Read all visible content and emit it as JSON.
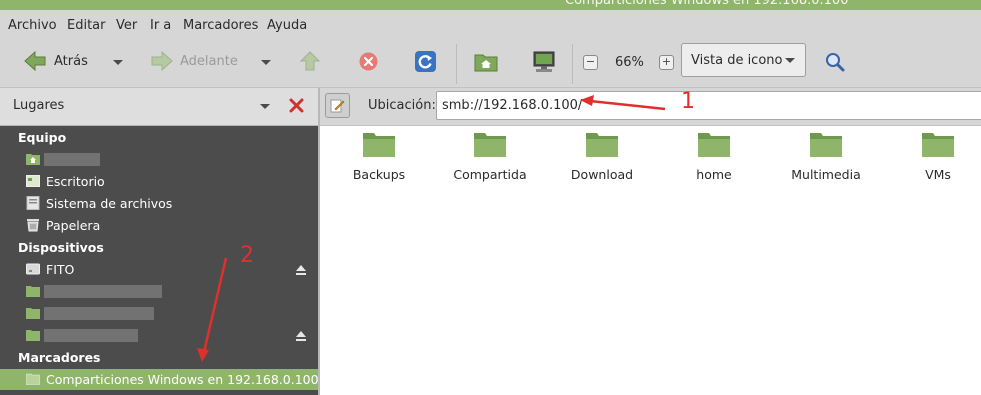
{
  "window": {
    "title": "Comparticiones Windows en 192.168.0.100"
  },
  "menubar": [
    "Archivo",
    "Editar",
    "Ver",
    "Ir a",
    "Marcadores",
    "Ayuda"
  ],
  "toolbar": {
    "back_label": "Atrás",
    "forward_label": "Adelante",
    "zoom_level": "66%",
    "view_mode": "Vista de icono"
  },
  "sidebar": {
    "header_title": "Lugares",
    "sections": {
      "equipo": "Equipo",
      "dispositivos": "Dispositivos",
      "marcadores": "Marcadores"
    },
    "equipo_items": [
      "Escritorio",
      "Sistema de archivos",
      "Papelera"
    ],
    "device_label": "FITO",
    "bookmark_label": "Comparticiones Windows en 192.168.0.100"
  },
  "location": {
    "label": "Ubicación:",
    "value": "smb://192.168.0.100/"
  },
  "folders": [
    "Backups",
    "Compartida",
    "Download",
    "home",
    "Multimedia",
    "VMs"
  ],
  "annotations": {
    "one": "1",
    "two": "2"
  },
  "colors": {
    "accent": "#8fb56a",
    "folder": "#7fa85a",
    "sidebar_bg": "#4c4c4c",
    "annotation": "#e0302d"
  }
}
